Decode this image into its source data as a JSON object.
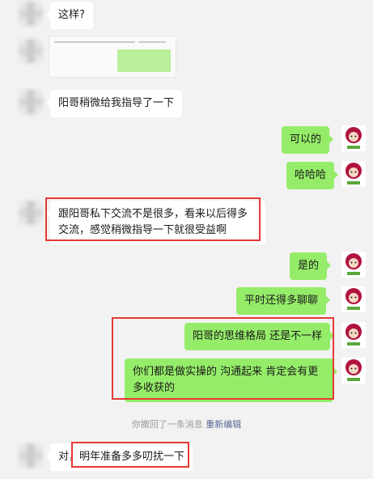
{
  "colors": {
    "background": "#f2f2f2",
    "incoming_bubble": "#ffffff",
    "outgoing_bubble": "#95ec69",
    "highlight": "#e53935",
    "link": "#576b95"
  },
  "messages": [
    {
      "side": "left",
      "text": "这样?"
    },
    {
      "side": "left",
      "type": "image-thumbnail"
    },
    {
      "side": "left",
      "text": "阳哥稍微给我指导了一下"
    },
    {
      "side": "right",
      "text": "可以的"
    },
    {
      "side": "right",
      "text": "哈哈哈"
    },
    {
      "side": "left",
      "text": "跟阳哥私下交流不是很多，看来以后得多交流，感觉稍微指导一下就很受益啊"
    },
    {
      "side": "right",
      "text": "是的"
    },
    {
      "side": "right",
      "text": "平时还得多聊聊"
    },
    {
      "side": "right",
      "text": "阳哥的思维格局 还是不一样"
    },
    {
      "side": "right",
      "text": "你们都是做实操的 沟通起来 肯定会有更多收获的"
    },
    {
      "side": "left",
      "text_prefix": "对，",
      "text": "明年准备多多叨扰一下"
    }
  ],
  "recall_notice": {
    "text": "你撤回了一条消息",
    "link": "重新编辑"
  },
  "icons": {
    "self_avatar": "cartoon-avatar-icon",
    "contact_avatar": "blurred-avatar-icon"
  }
}
